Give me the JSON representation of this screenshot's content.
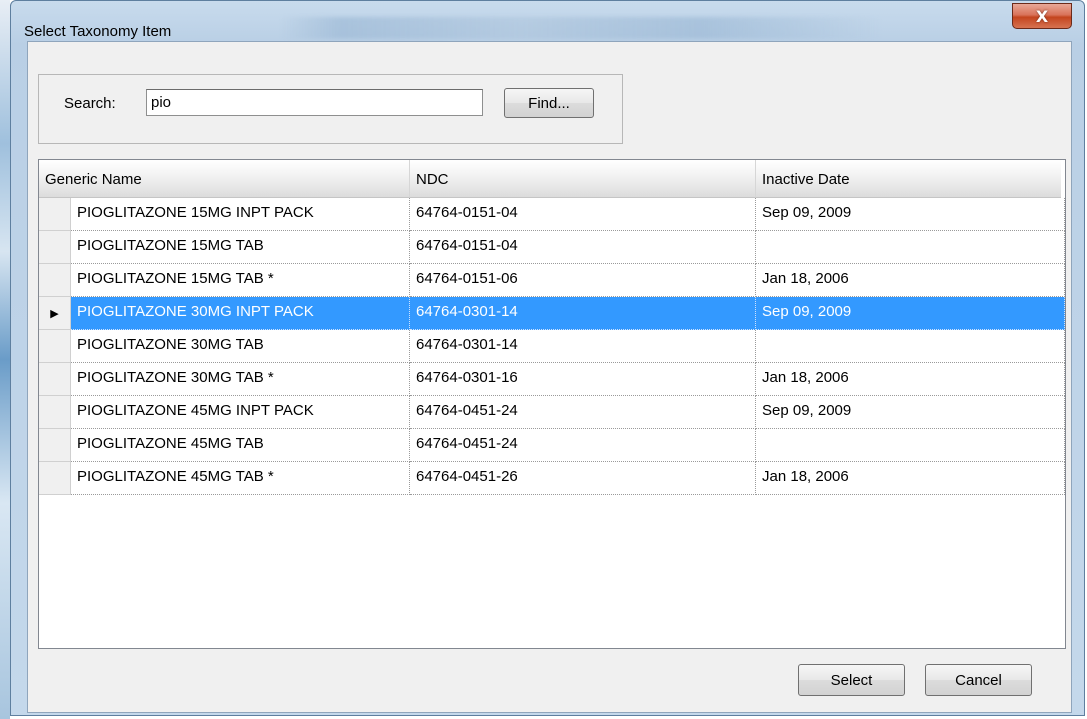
{
  "window": {
    "title": "Select Taxonomy Item",
    "close_glyph": "X"
  },
  "search": {
    "label": "Search:",
    "value": "pio",
    "find_label": "Find..."
  },
  "grid": {
    "columns": [
      "Generic Name",
      "NDC",
      "Inactive Date"
    ],
    "row_indicator": "▶",
    "selected_index": 3,
    "rows": [
      {
        "generic_name": "PIOGLITAZONE 15MG INPT PACK",
        "ndc": "64764-0151-04",
        "inactive_date": "Sep 09, 2009"
      },
      {
        "generic_name": "PIOGLITAZONE 15MG TAB",
        "ndc": "64764-0151-04",
        "inactive_date": ""
      },
      {
        "generic_name": "PIOGLITAZONE 15MG TAB *",
        "ndc": "64764-0151-06",
        "inactive_date": "Jan 18, 2006"
      },
      {
        "generic_name": "PIOGLITAZONE 30MG INPT PACK",
        "ndc": "64764-0301-14",
        "inactive_date": "Sep 09, 2009"
      },
      {
        "generic_name": "PIOGLITAZONE 30MG TAB",
        "ndc": "64764-0301-14",
        "inactive_date": ""
      },
      {
        "generic_name": "PIOGLITAZONE 30MG TAB *",
        "ndc": "64764-0301-16",
        "inactive_date": "Jan 18, 2006"
      },
      {
        "generic_name": "PIOGLITAZONE 45MG INPT PACK",
        "ndc": "64764-0451-24",
        "inactive_date": "Sep 09, 2009"
      },
      {
        "generic_name": "PIOGLITAZONE 45MG TAB",
        "ndc": "64764-0451-24",
        "inactive_date": ""
      },
      {
        "generic_name": "PIOGLITAZONE 45MG TAB *",
        "ndc": "64764-0451-26",
        "inactive_date": "Jan 18, 2006"
      }
    ]
  },
  "buttons": {
    "select_label": "Select",
    "cancel_label": "Cancel"
  },
  "colors": {
    "selection": "#3399ff",
    "close_button": "#c4451f"
  }
}
